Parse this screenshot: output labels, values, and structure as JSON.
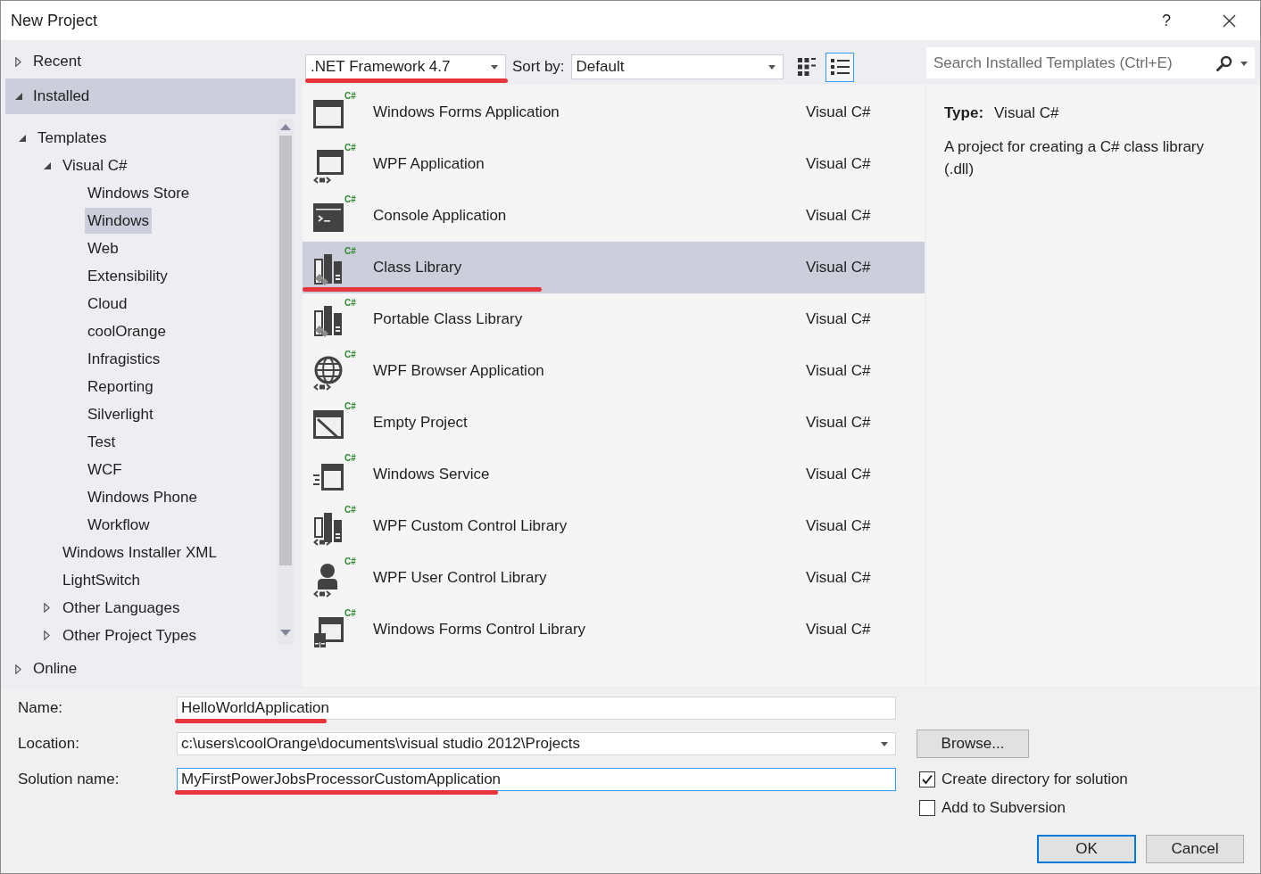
{
  "window": {
    "title": "New Project",
    "help": "?"
  },
  "sidebar": {
    "sections": [
      {
        "label": "Recent",
        "expanded": false,
        "selected": false
      },
      {
        "label": "Installed",
        "expanded": true,
        "selected": true,
        "children": [
          {
            "label": "Templates",
            "expanded": true,
            "selected": false,
            "children": [
              {
                "label": "Visual C#",
                "expanded": true,
                "selected": false,
                "children": [
                  {
                    "label": "Windows Store",
                    "selected": false
                  },
                  {
                    "label": "Windows",
                    "selected": true
                  },
                  {
                    "label": "Web",
                    "selected": false
                  },
                  {
                    "label": "Extensibility",
                    "selected": false
                  },
                  {
                    "label": "Cloud",
                    "selected": false
                  },
                  {
                    "label": "coolOrange",
                    "selected": false
                  },
                  {
                    "label": "Infragistics",
                    "selected": false
                  },
                  {
                    "label": "Reporting",
                    "selected": false
                  },
                  {
                    "label": "Silverlight",
                    "selected": false
                  },
                  {
                    "label": "Test",
                    "selected": false
                  },
                  {
                    "label": "WCF",
                    "selected": false
                  },
                  {
                    "label": "Windows Phone",
                    "selected": false
                  },
                  {
                    "label": "Workflow",
                    "selected": false
                  }
                ]
              },
              {
                "label": "Windows Installer XML",
                "selected": false
              },
              {
                "label": "LightSwitch",
                "selected": false
              },
              {
                "label": "Other Languages",
                "expanded": false,
                "selected": false
              },
              {
                "label": "Other Project Types",
                "expanded": false,
                "selected": false
              }
            ]
          }
        ]
      },
      {
        "label": "Online",
        "expanded": false,
        "selected": false
      }
    ]
  },
  "toolbar": {
    "framework": {
      "value": ".NET Framework 4.7",
      "annotated": true
    },
    "sort_label": "Sort by:",
    "sort": {
      "value": "Default",
      "annotated": false
    },
    "view_buttons": [
      {
        "kind": "grid",
        "selected": false
      },
      {
        "kind": "list",
        "selected": true
      }
    ],
    "search": {
      "placeholder": "Search Installed Templates (Ctrl+E)"
    }
  },
  "templates": [
    {
      "name": "Windows Forms Application",
      "language": "Visual C#",
      "badge": "C#",
      "kind": "windows-forms",
      "selected": false,
      "annotated": false
    },
    {
      "name": "WPF Application",
      "language": "Visual C#",
      "badge": "C#",
      "kind": "wpf",
      "selected": false,
      "annotated": false
    },
    {
      "name": "Console Application",
      "language": "Visual C#",
      "badge": "C#",
      "kind": "console",
      "selected": false,
      "annotated": false
    },
    {
      "name": "Class Library",
      "language": "Visual C#",
      "badge": "C#",
      "kind": "class-library",
      "selected": true,
      "annotated": true
    },
    {
      "name": "Portable Class Library",
      "language": "Visual C#",
      "badge": "C#",
      "kind": "portable-library",
      "selected": false,
      "annotated": false
    },
    {
      "name": "WPF Browser Application",
      "language": "Visual C#",
      "badge": "C#",
      "kind": "browser",
      "selected": false,
      "annotated": false
    },
    {
      "name": "Empty Project",
      "language": "Visual C#",
      "badge": "C#",
      "kind": "empty",
      "selected": false,
      "annotated": false
    },
    {
      "name": "Windows Service",
      "language": "Visual C#",
      "badge": "C#",
      "kind": "service",
      "selected": false,
      "annotated": false
    },
    {
      "name": "WPF Custom Control Library",
      "language": "Visual C#",
      "badge": "C#",
      "kind": "custom-control",
      "selected": false,
      "annotated": false
    },
    {
      "name": "WPF User Control Library",
      "language": "Visual C#",
      "badge": "C#",
      "kind": "user-control",
      "selected": false,
      "annotated": false
    },
    {
      "name": "Windows Forms Control Library",
      "language": "Visual C#",
      "badge": "C#",
      "kind": "forms-control",
      "selected": false,
      "annotated": false
    }
  ],
  "details": {
    "type_label": "Type:",
    "type_value": "Visual C#",
    "description": "A project for creating a C# class library (.dll)"
  },
  "form": {
    "fields": [
      {
        "label": "Name:",
        "value": "HelloWorldApplication",
        "kind": "text",
        "focused": false,
        "annotated": true
      },
      {
        "label": "Location:",
        "value": "c:\\users\\coolOrange\\documents\\visual studio 2012\\Projects",
        "kind": "combo",
        "focused": false,
        "annotated": false
      },
      {
        "label": "Solution name:",
        "value": "MyFirstPowerJobsProcessorCustomApplication",
        "kind": "text",
        "focused": true,
        "annotated": true
      }
    ],
    "browse_button": "Browse...",
    "checkboxes": [
      {
        "label": "Create directory for solution",
        "checked": true
      },
      {
        "label": "Add to Subversion",
        "checked": false
      }
    ],
    "buttons": [
      {
        "label": "OK",
        "default": true
      },
      {
        "label": "Cancel",
        "default": false
      }
    ]
  }
}
